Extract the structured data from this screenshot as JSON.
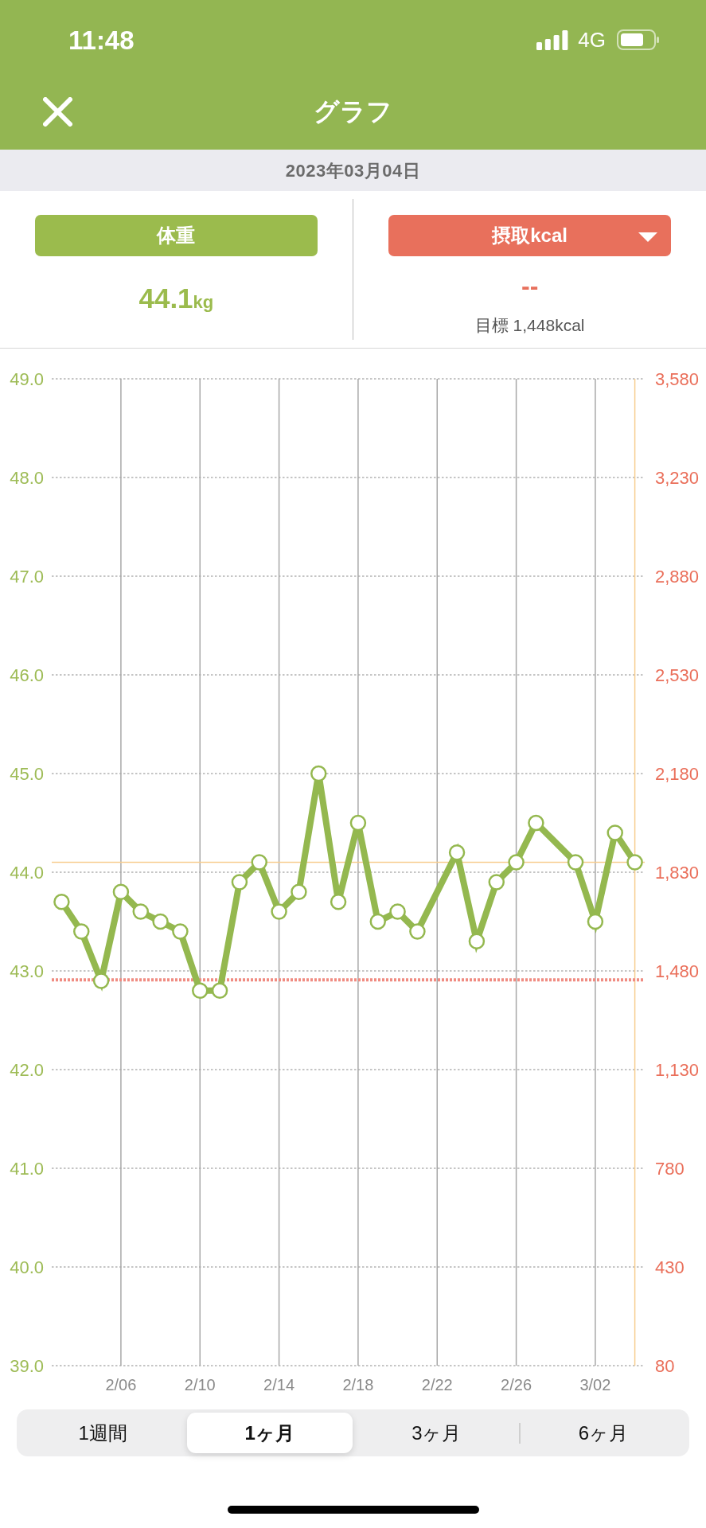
{
  "status_bar": {
    "time": "11:48",
    "network": "4G"
  },
  "header": {
    "title": "グラフ"
  },
  "date_bar": {
    "date": "2023年03月04日"
  },
  "summary": [
    {
      "kind": "weight",
      "label": "体重",
      "color": "#9bbb4d",
      "value": "44.1",
      "unit": "kg"
    },
    {
      "kind": "intake",
      "label": "摂取kcal",
      "color": "#e8705c",
      "dropdown": true,
      "value": "--",
      "target": "目標 1,448kcal"
    }
  ],
  "chart": {
    "chart_data": {
      "type": "line",
      "categories": [
        null,
        null,
        null,
        "2/06",
        null,
        null,
        null,
        "2/10",
        null,
        null,
        null,
        "2/14",
        null,
        null,
        null,
        "2/18",
        null,
        null,
        null,
        "2/22",
        null,
        null,
        null,
        "2/26",
        null,
        null,
        null,
        "3/02",
        null,
        null
      ],
      "series": [
        {
          "color": "#94b84f",
          "marker": true,
          "values": [
            43.7,
            43.4,
            42.9,
            43.8,
            43.6,
            43.5,
            43.4,
            42.8,
            42.8,
            43.9,
            44.1,
            43.6,
            43.8,
            45.0,
            43.7,
            44.5,
            43.5,
            43.6,
            43.4,
            null,
            44.2,
            43.3,
            43.9,
            44.1,
            44.5,
            null,
            44.1,
            43.5,
            44.4,
            44.1
          ]
        }
      ],
      "ylim": [
        39,
        49
      ],
      "yticks": [
        {
          "value": 39,
          "label": "39.0"
        },
        {
          "value": 40,
          "label": "40.0"
        },
        {
          "value": 41,
          "label": "41.0"
        },
        {
          "value": 42,
          "label": "42.0"
        },
        {
          "value": 43,
          "label": "43.0"
        },
        {
          "value": 44,
          "label": "44.0"
        },
        {
          "value": 45,
          "label": "45.0"
        },
        {
          "value": 46,
          "label": "46.0"
        },
        {
          "value": 47,
          "label": "47.0"
        },
        {
          "value": 48,
          "label": "48.0"
        },
        {
          "value": 49,
          "label": "49.0"
        }
      ],
      "grid": true,
      "ref_lines": [
        {
          "axis": "y",
          "value": 42.91,
          "color": "#f08c82"
        },
        {
          "axis": "y",
          "value": 44.1,
          "color": "#f7cd8f"
        }
      ]
    },
    "kcal_axis_labels": [
      "3,580",
      "3,230",
      "2,880",
      "2,530",
      "2,180",
      "1,830",
      "1,480",
      "1,130",
      "780",
      "430",
      "80"
    ]
  },
  "period_tabs": [
    {
      "label": "1週間",
      "selected": false
    },
    {
      "label": "1ヶ月",
      "selected": true
    },
    {
      "label": "3ヶ月",
      "selected": false
    },
    {
      "label": "6ヶ月",
      "selected": false
    }
  ]
}
